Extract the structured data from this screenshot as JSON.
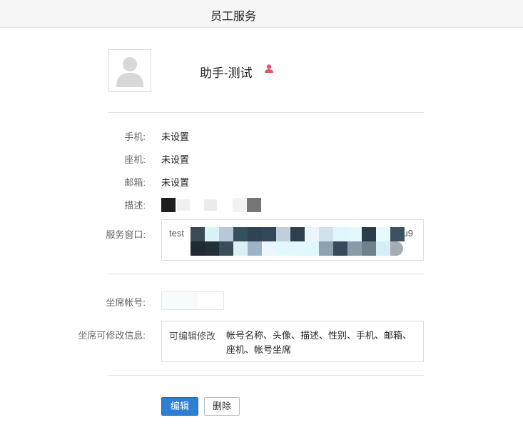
{
  "header": {
    "title": "员工服务"
  },
  "profile": {
    "name": "助手-测试",
    "avatar_icon": "user-placeholder-icon",
    "badge_icon": "person-icon",
    "badge_color": "#e0566b"
  },
  "fields": {
    "phone": {
      "label": "手机:",
      "value": "未设置"
    },
    "landline": {
      "label": "座机:",
      "value": "未设置"
    },
    "email": {
      "label": "邮箱:",
      "value": "未设置"
    },
    "description": {
      "label": "描述:"
    },
    "service_window": {
      "label": "服务窗口:",
      "value_prefix": "test",
      "value_suffix": "u9"
    },
    "seat_account": {
      "label": "坐席帐号:"
    },
    "seat_editable": {
      "label": "坐席可修改信息:",
      "key": "可编辑修改",
      "value": "帐号名称、头像、描述、性别、手机、邮箱、座机、帐号坐席"
    }
  },
  "actions": {
    "edit_label": "编辑",
    "delete_label": "删除"
  },
  "colors": {
    "primary": "#2d7fd4",
    "badge": "#e0566b"
  }
}
